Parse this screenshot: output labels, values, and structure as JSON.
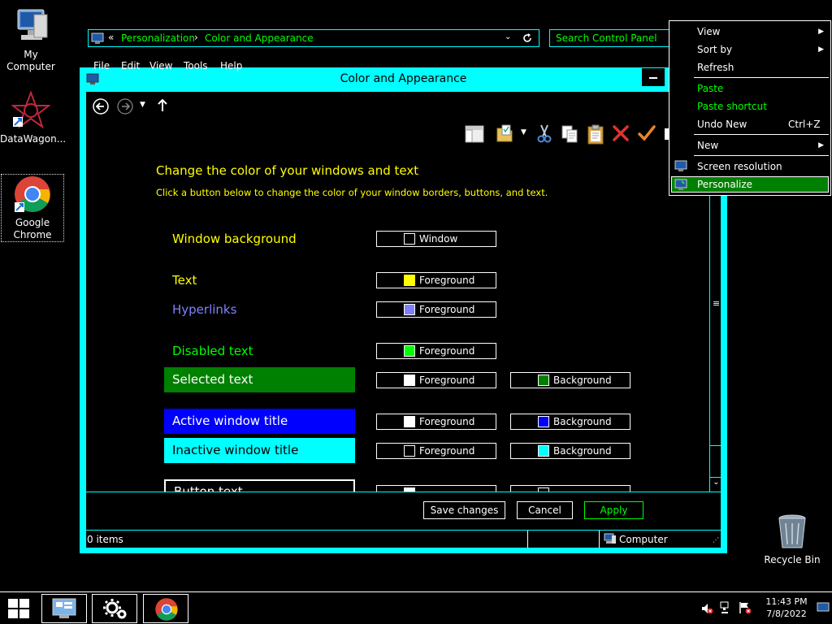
{
  "desktop": {
    "icons": [
      {
        "label": "My Computer"
      },
      {
        "label": "DataWagon..."
      },
      {
        "label": "Google Chrome"
      },
      {
        "label": "Recycle Bin"
      }
    ]
  },
  "window": {
    "title": "Color and Appearance",
    "nav": {
      "prefix": "«",
      "crumb1": "Personalization",
      "sep": "›",
      "crumb2": "Color and Appearance",
      "search_placeholder": "Search Control Panel"
    },
    "menu": [
      "File",
      "Edit",
      "View",
      "Tools",
      "Help"
    ],
    "heading": "Change the color of your windows and text",
    "subheading": "Click a button below to change the color of your window borders, buttons, and text.",
    "rows": [
      {
        "label": "Window background",
        "fg_label": "Window",
        "fg_swatch": "#000000"
      },
      {
        "label": "Text",
        "fg_label": "Foreground",
        "fg_swatch": "#ffff00"
      },
      {
        "label": "Hyperlinks",
        "fg_label": "Foreground",
        "fg_swatch": "#8080ff"
      },
      {
        "label": "Disabled text",
        "fg_label": "Foreground",
        "fg_swatch": "#00ff00"
      },
      {
        "label": "Selected text",
        "fg_label": "Foreground",
        "fg_swatch": "#ffffff",
        "bg_label": "Background",
        "bg_swatch": "#008000"
      },
      {
        "label": "Active window title",
        "fg_label": "Foreground",
        "fg_swatch": "#ffffff",
        "bg_label": "Background",
        "bg_swatch": "#0000ff"
      },
      {
        "label": "Inactive window title",
        "fg_label": "Foreground",
        "fg_swatch": "#000000",
        "bg_label": "Background",
        "bg_swatch": "#00ffff"
      },
      {
        "label": "Button text"
      }
    ],
    "buttons": {
      "save": "Save changes",
      "cancel": "Cancel",
      "apply": "Apply"
    },
    "status": {
      "items": "0 items",
      "location": "Computer"
    }
  },
  "context_menu": {
    "items": [
      {
        "label": "View"
      },
      {
        "label": "Sort by"
      },
      {
        "label": "Refresh"
      },
      {
        "label": "Paste"
      },
      {
        "label": "Paste shortcut"
      },
      {
        "label": "Undo New",
        "shortcut": "Ctrl+Z"
      },
      {
        "label": "New"
      },
      {
        "label": "Screen resolution"
      },
      {
        "label": "Personalize"
      }
    ]
  },
  "taskbar": {
    "time": "11:43 PM",
    "date": "7/8/2022"
  },
  "colors": {
    "accent_cyan": "#00ffff",
    "text_yellow": "#ffff00",
    "hyperlink": "#8080ff",
    "disabled_green": "#00ff00",
    "selected_bg": "#008000",
    "active_title_bg": "#0000ff"
  }
}
